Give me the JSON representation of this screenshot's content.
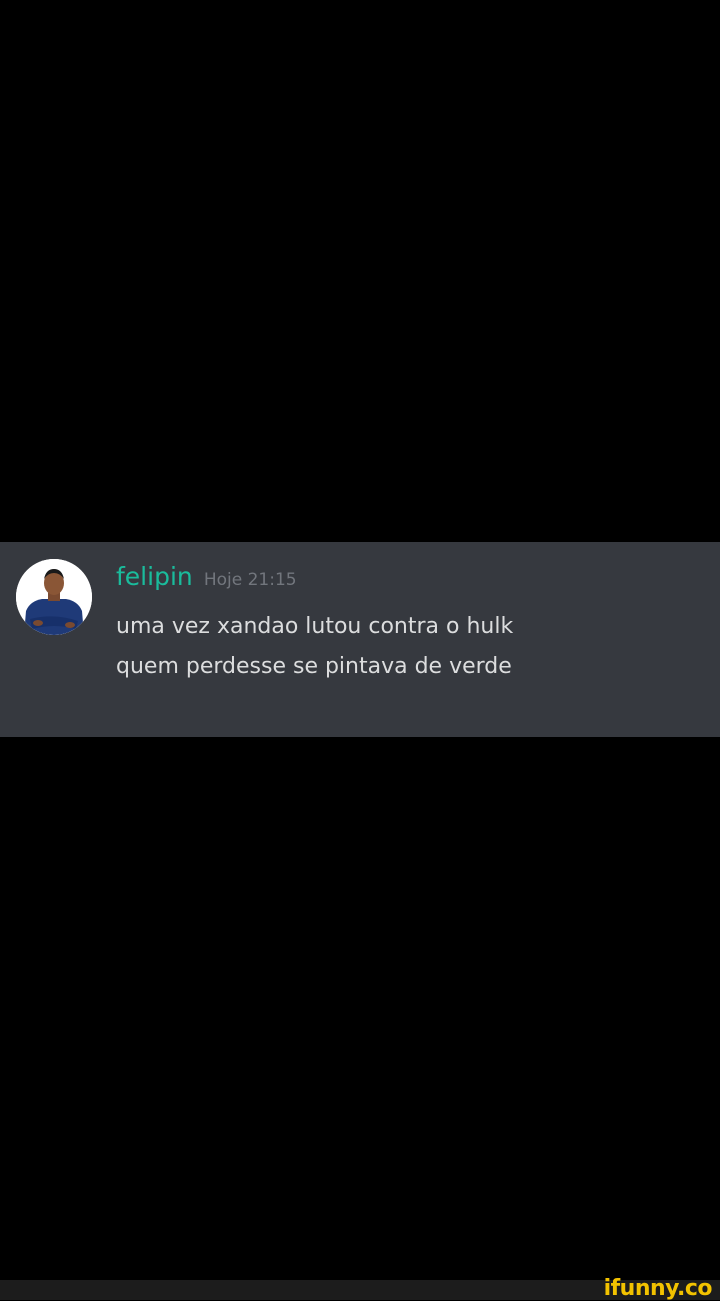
{
  "message": {
    "username": "felipin",
    "timestamp": "Hoje 21:15",
    "lines": [
      "uma vez xandao lutou contra o hulk",
      "quem perdesse se pintava de verde"
    ]
  },
  "watermark": {
    "text": "ifunny.co"
  },
  "colors": {
    "background": "#000000",
    "message_background": "#36393f",
    "username": "#1abc9c",
    "timestamp": "#72767d",
    "message_text": "#dcddde",
    "watermark": "#f2c200"
  }
}
